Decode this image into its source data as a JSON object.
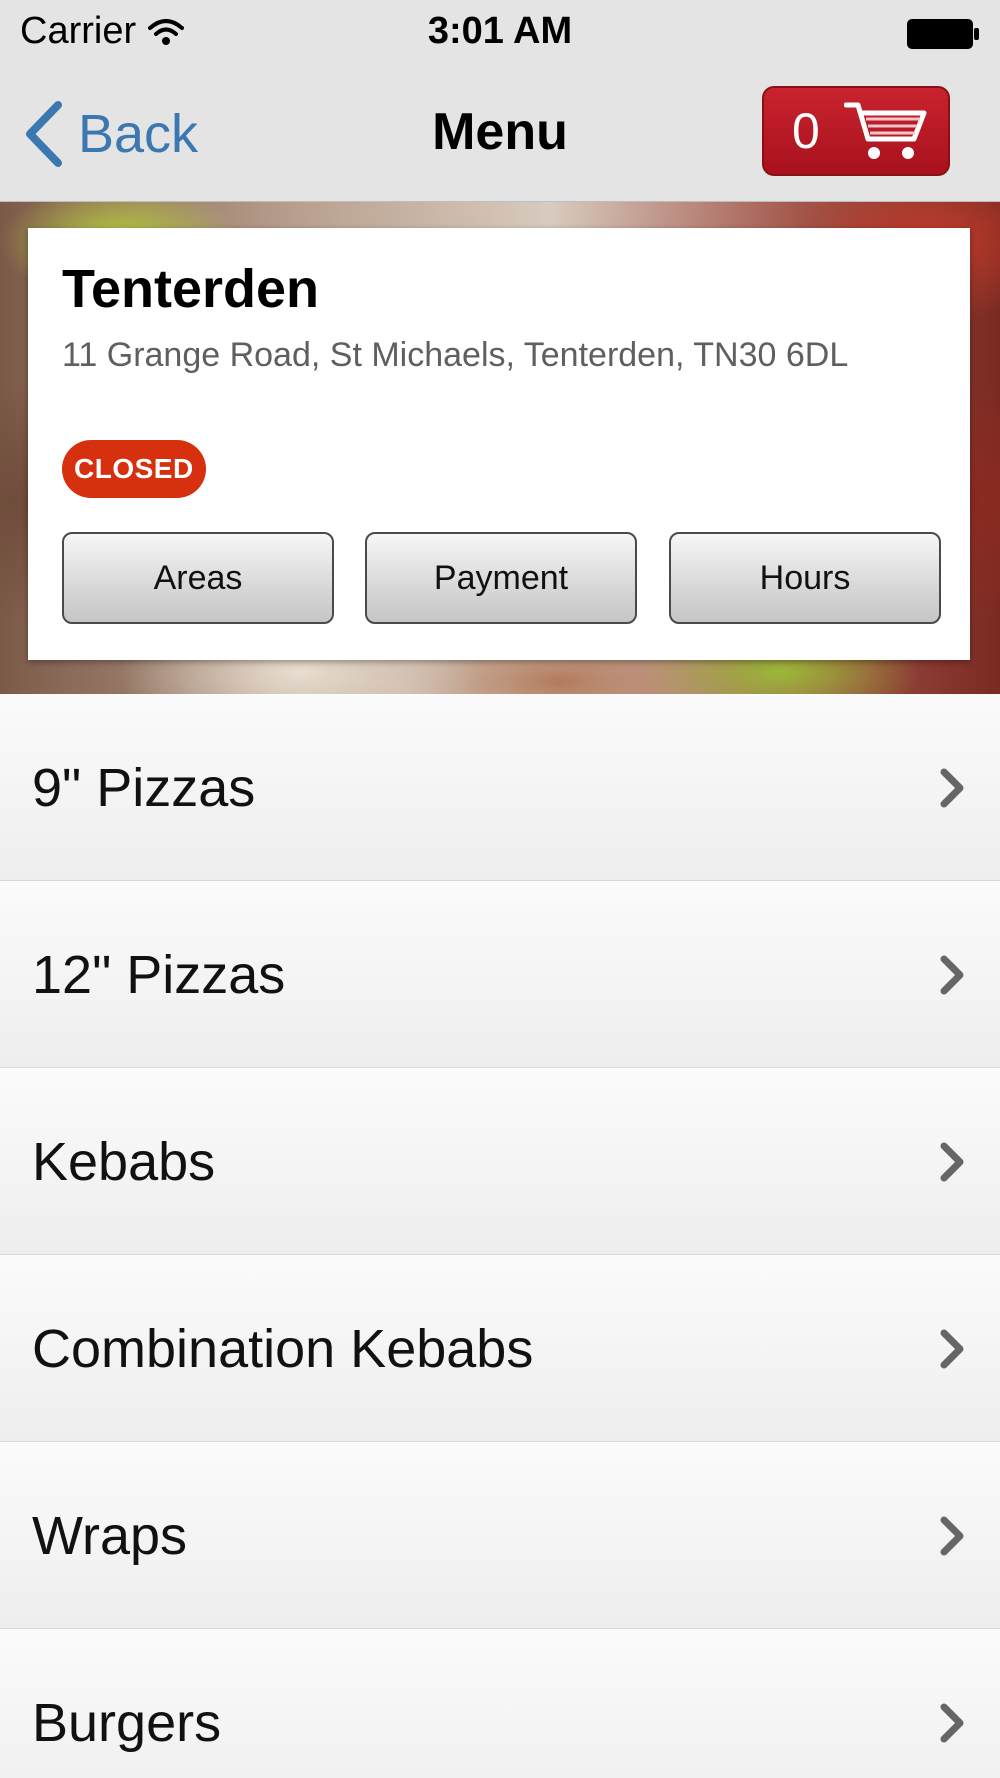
{
  "status_bar": {
    "carrier": "Carrier",
    "time": "3:01 AM"
  },
  "nav": {
    "back_label": "Back",
    "title": "Menu",
    "cart_count": "0"
  },
  "store": {
    "name": "Tenterden",
    "address": "11 Grange Road, St Michaels, Tenterden, TN30 6DL",
    "status": "CLOSED",
    "buttons": [
      "Areas",
      "Payment",
      "Hours"
    ]
  },
  "menu": {
    "items": [
      "9\" Pizzas",
      "12\" Pizzas",
      "Kebabs",
      "Combination Kebabs",
      "Wraps",
      "Burgers"
    ]
  },
  "colors": {
    "accent_blue": "#3b77b0",
    "cart_red": "#b51b26",
    "closed_badge": "#d7300f"
  },
  "icons": [
    "wifi-icon",
    "battery-icon",
    "chevron-left-icon",
    "cart-icon",
    "chevron-right-icon"
  ]
}
